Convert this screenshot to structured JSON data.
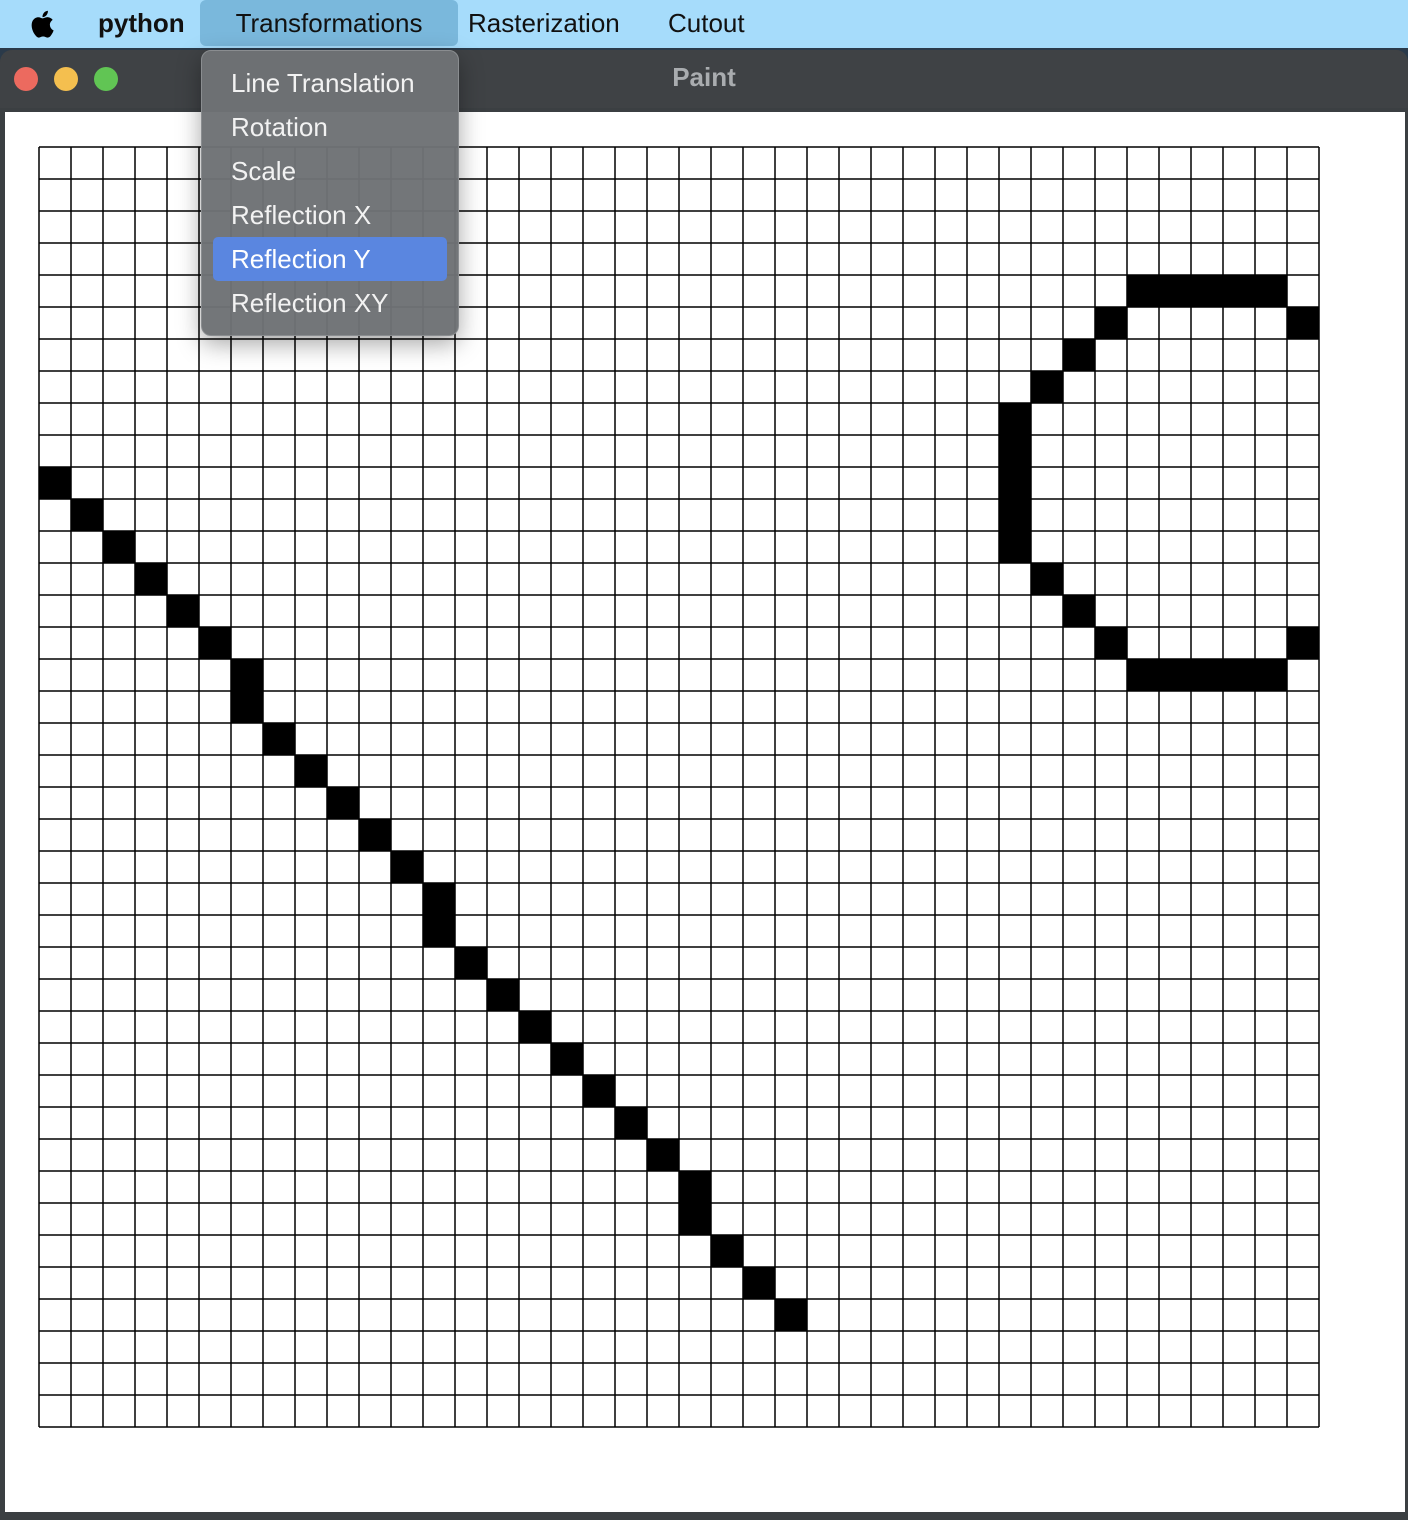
{
  "menubar": {
    "apple_icon": "apple-logo-icon",
    "app_name": "python",
    "menus": [
      "Transformations",
      "Rasterization",
      "Cutout"
    ]
  },
  "window": {
    "title": "Paint",
    "controls": [
      "close",
      "minimize",
      "zoom"
    ]
  },
  "dropdown": {
    "menu": "Transformations",
    "items": [
      "Line Translation",
      "Rotation",
      "Scale",
      "Reflection X",
      "Reflection Y",
      "Reflection XY"
    ],
    "highlighted": "Reflection Y"
  },
  "grid": {
    "columns": 40,
    "rows": 40,
    "filled_cells": [
      [
        0,
        10
      ],
      [
        1,
        11
      ],
      [
        2,
        12
      ],
      [
        3,
        13
      ],
      [
        4,
        14
      ],
      [
        5,
        15
      ],
      [
        6,
        16
      ],
      [
        6,
        17
      ],
      [
        7,
        18
      ],
      [
        8,
        19
      ],
      [
        9,
        20
      ],
      [
        10,
        21
      ],
      [
        11,
        22
      ],
      [
        12,
        23
      ],
      [
        12,
        24
      ],
      [
        13,
        25
      ],
      [
        14,
        26
      ],
      [
        15,
        27
      ],
      [
        16,
        28
      ],
      [
        17,
        29
      ],
      [
        18,
        30
      ],
      [
        19,
        31
      ],
      [
        20,
        32
      ],
      [
        20,
        33
      ],
      [
        21,
        34
      ],
      [
        22,
        35
      ],
      [
        23,
        36
      ],
      [
        34,
        4
      ],
      [
        35,
        4
      ],
      [
        36,
        4
      ],
      [
        37,
        4
      ],
      [
        38,
        4
      ],
      [
        33,
        5
      ],
      [
        39,
        5
      ],
      [
        32,
        6
      ],
      [
        31,
        7
      ],
      [
        30,
        8
      ],
      [
        30,
        9
      ],
      [
        30,
        10
      ],
      [
        30,
        11
      ],
      [
        30,
        12
      ],
      [
        31,
        13
      ],
      [
        32,
        14
      ],
      [
        33,
        15
      ],
      [
        39,
        15
      ],
      [
        34,
        16
      ],
      [
        35,
        16
      ],
      [
        36,
        16
      ],
      [
        37,
        16
      ],
      [
        38,
        16
      ]
    ]
  },
  "colors": {
    "menubar_bg": "#a6dcfb",
    "selection": "#5a86e0",
    "filled_cell": "#000000",
    "cell_bg": "#ffffff"
  }
}
